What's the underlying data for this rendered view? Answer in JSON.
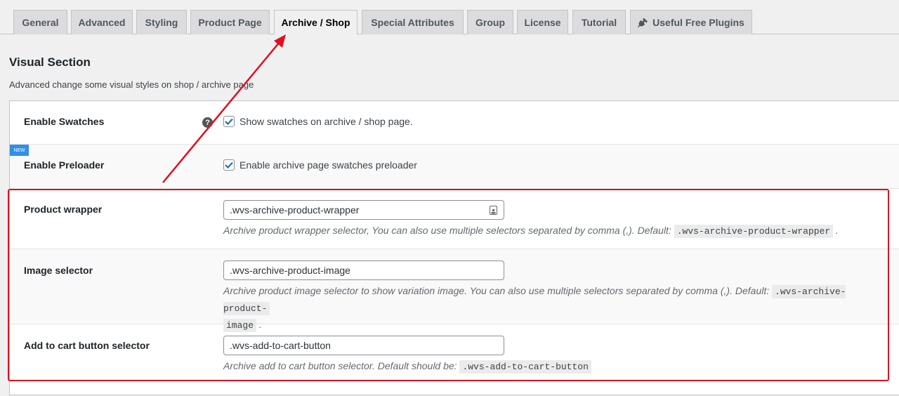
{
  "tabs": [
    {
      "label": "General",
      "active": false
    },
    {
      "label": "Advanced",
      "active": false
    },
    {
      "label": "Styling",
      "active": false
    },
    {
      "label": "Product Page",
      "active": false
    },
    {
      "label": "Archive / Shop",
      "active": true
    },
    {
      "label": "Special Attributes",
      "active": false
    },
    {
      "label": "Group",
      "active": false
    },
    {
      "label": "License",
      "active": false
    },
    {
      "label": "Tutorial",
      "active": false
    },
    {
      "label": "Useful Free Plugins",
      "active": false,
      "icon": "plug-icon"
    }
  ],
  "section": {
    "title": "Visual Section",
    "description": "Advanced change some visual styles on shop / archive page"
  },
  "rows": {
    "swatches": {
      "label": "Enable Swatches",
      "help_icon": "question-icon",
      "checked": true,
      "checkbox_label": "Show swatches on archive / shop page."
    },
    "preloader": {
      "badge": "NEW",
      "label": "Enable Preloader",
      "checked": true,
      "checkbox_label": "Enable archive page swatches preloader"
    },
    "product_wrapper": {
      "label": "Product wrapper",
      "value": ".wvs-archive-product-wrapper",
      "desc": "Archive product wrapper selector, You can also use multiple selectors separated by comma (,). Default:",
      "default": ".wvs-archive-product-wrapper",
      "suffix": "."
    },
    "image_selector": {
      "label": "Image selector",
      "value": ".wvs-archive-product-image",
      "desc": "Archive product image selector to show variation image. You can also use multiple selectors separated by comma (,). Default:",
      "default_part1": ".wvs-archive-product-",
      "default_part2": "image",
      "suffix": "."
    },
    "add_to_cart": {
      "label": "Add to cart button selector",
      "value": ".wvs-add-to-cart-button",
      "desc": "Archive add to cart button selector. Default should be:",
      "default": ".wvs-add-to-cart-button"
    }
  },
  "colors": {
    "annotation": "#e0101e",
    "checkbox": "#2271b1",
    "badge": "#2e90e8"
  }
}
